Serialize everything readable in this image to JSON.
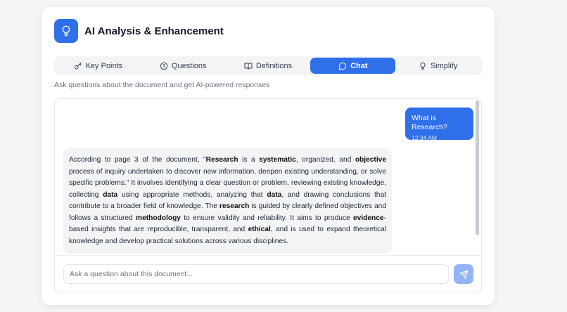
{
  "header": {
    "title": "AI Analysis & Enhancement",
    "icon": "lightbulb-icon"
  },
  "tabs": [
    {
      "label": "Key Points",
      "icon": "key-icon",
      "active": false
    },
    {
      "label": "Questions",
      "icon": "question-circle-icon",
      "active": false
    },
    {
      "label": "Definitions",
      "icon": "book-icon",
      "active": false
    },
    {
      "label": "Chat",
      "icon": "chat-bubble-icon",
      "active": true
    },
    {
      "label": "Simplify",
      "icon": "lightbulb-icon",
      "active": false
    }
  ],
  "subtitle": "Ask questions about the document and get AI-powered responses",
  "chat": {
    "user_message": {
      "text": "What is Research?",
      "time": "12:34 AM"
    },
    "ai_message": {
      "segments": [
        {
          "t": "According to page 3 of the document, \"",
          "b": false
        },
        {
          "t": "Research",
          "b": true
        },
        {
          "t": " is a ",
          "b": false
        },
        {
          "t": "systematic",
          "b": true
        },
        {
          "t": ", organized, and ",
          "b": false
        },
        {
          "t": "objective",
          "b": true
        },
        {
          "t": " process of inquiry undertaken to discover new information, deepen existing understanding, or solve specific problems.\" It involves identifying a clear question or problem, reviewing existing knowledge, collecting ",
          "b": false
        },
        {
          "t": "data",
          "b": true
        },
        {
          "t": " using appropriate methods, analyzing that ",
          "b": false
        },
        {
          "t": "data",
          "b": true
        },
        {
          "t": ", and drawing conclusions that contribute to a broader field of knowledge. The ",
          "b": false
        },
        {
          "t": "research",
          "b": true
        },
        {
          "t": " is guided by clearly defined objectives and follows a structured ",
          "b": false
        },
        {
          "t": "methodology",
          "b": true
        },
        {
          "t": " to ensure validity and reliability. It aims to produce ",
          "b": false
        },
        {
          "t": "evidence",
          "b": true
        },
        {
          "t": "-based insights that are reproducible, transparent, and ",
          "b": false
        },
        {
          "t": "ethical",
          "b": true
        },
        {
          "t": ", and is used to expand theoretical knowledge and develop practical solutions across various disciplines.",
          "b": false
        }
      ]
    },
    "input_placeholder": "Ask a question about this document...",
    "input_value": ""
  },
  "colors": {
    "accent": "#2f6fe9",
    "send_button": "#94b5f5",
    "tab_bar": "#f3f4f6",
    "ai_bubble": "#f3f4f6"
  }
}
